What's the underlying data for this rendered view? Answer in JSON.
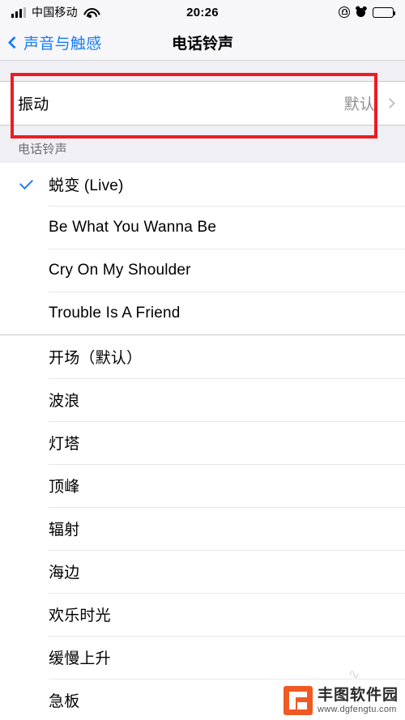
{
  "status_bar": {
    "carrier": "中国移动",
    "time": "20:26",
    "icons": {
      "signal": "signal-bars-icon",
      "wifi": "wifi-icon",
      "rotation_lock": "rotation-lock-icon",
      "alarm": "alarm-clock-icon",
      "battery": "battery-full-icon"
    }
  },
  "nav_bar": {
    "back_label": "声音与触感",
    "title": "电话铃声",
    "back_icon": "chevron-left-icon",
    "accent_color": "#1a7cf5"
  },
  "vibration": {
    "label": "振动",
    "value": "默认",
    "chevron_icon": "chevron-right-icon"
  },
  "section": {
    "header": "电话铃声"
  },
  "ringtones_custom": [
    {
      "label": "蜕变 (Live)",
      "selected": true
    },
    {
      "label": "Be What You Wanna Be",
      "selected": false
    },
    {
      "label": "Cry On My Shoulder",
      "selected": false
    },
    {
      "label": "Trouble Is A Friend",
      "selected": false
    }
  ],
  "ringtones_system": [
    {
      "label": "开场（默认）",
      "selected": false
    },
    {
      "label": "波浪",
      "selected": false
    },
    {
      "label": "灯塔",
      "selected": false
    },
    {
      "label": "顶峰",
      "selected": false
    },
    {
      "label": "辐射",
      "selected": false
    },
    {
      "label": "海边",
      "selected": false
    },
    {
      "label": "欢乐时光",
      "selected": false
    },
    {
      "label": "缓慢上升",
      "selected": false
    },
    {
      "label": "急板",
      "selected": false
    }
  ],
  "annotation": {
    "color": "#ec1c24",
    "target": "vibration-row"
  },
  "watermark": {
    "title": "丰图软件园",
    "url": "www.dgfengtu.com",
    "logo_color": "#f05a22"
  }
}
